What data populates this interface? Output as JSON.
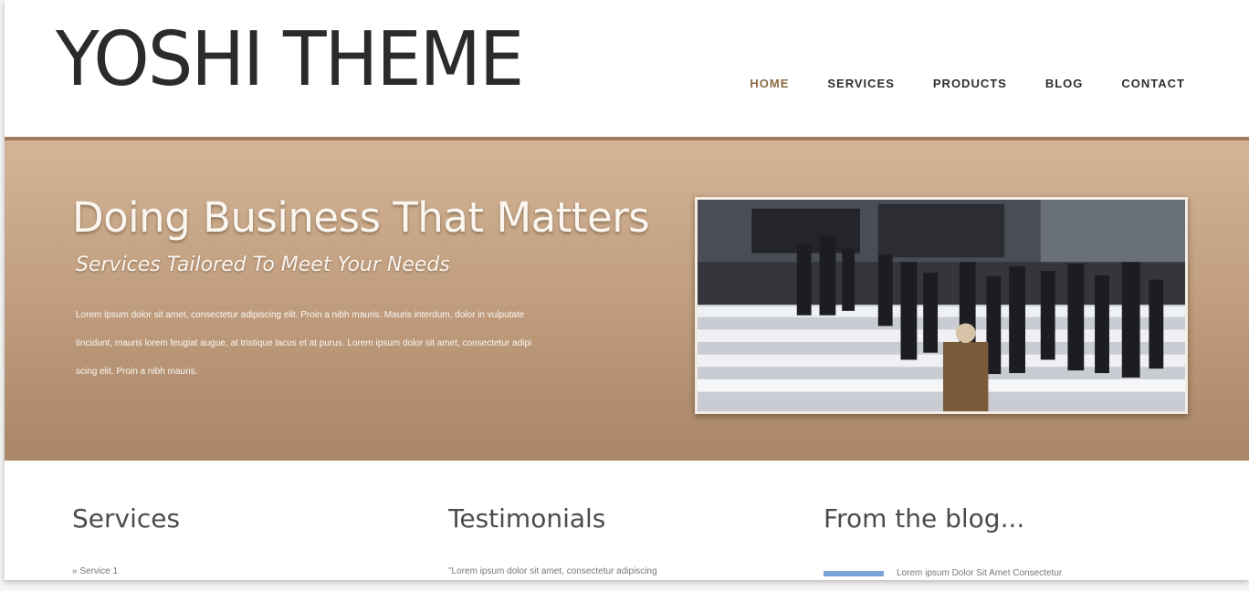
{
  "header": {
    "logo": "YOSHI THEME",
    "nav": [
      "HOME",
      "SERVICES",
      "PRODUCTS",
      "BLOG",
      "CONTACT"
    ],
    "active_nav": "HOME"
  },
  "hero": {
    "title": "Doing Business That Matters",
    "subtitle": "Services Tailored To Meet Your Needs",
    "body": "Lorem ipsum dolor sit amet, consectetur adipiscing elit. Proin a nibh mauris. Mauris interdum, dolor in vulputate tincidunt, mauris lorem feugiat augue, at tristique lacus et at purus. Lorem ipsum dolor sit amet, consectetur adipi scing elit. Proin a nibh mauris."
  },
  "columns": {
    "services": {
      "title": "Services",
      "item": "» Service 1"
    },
    "testimonials": {
      "title": "Testimonials",
      "text": "\"Lorem ipsum dolor sit amet, consectetur adipiscing"
    },
    "blog": {
      "title": "From the blog...",
      "item": "Lorem ipsum Dolor Sit Amet Consectetur"
    }
  },
  "colors": {
    "accent": "#8a6a45",
    "hero_top": "#d3b596",
    "hero_bottom": "#a88666",
    "text_dark": "#2b2b2b"
  },
  "icons": {
    "hero_image": "city-crowd-crosswalk-photo"
  }
}
